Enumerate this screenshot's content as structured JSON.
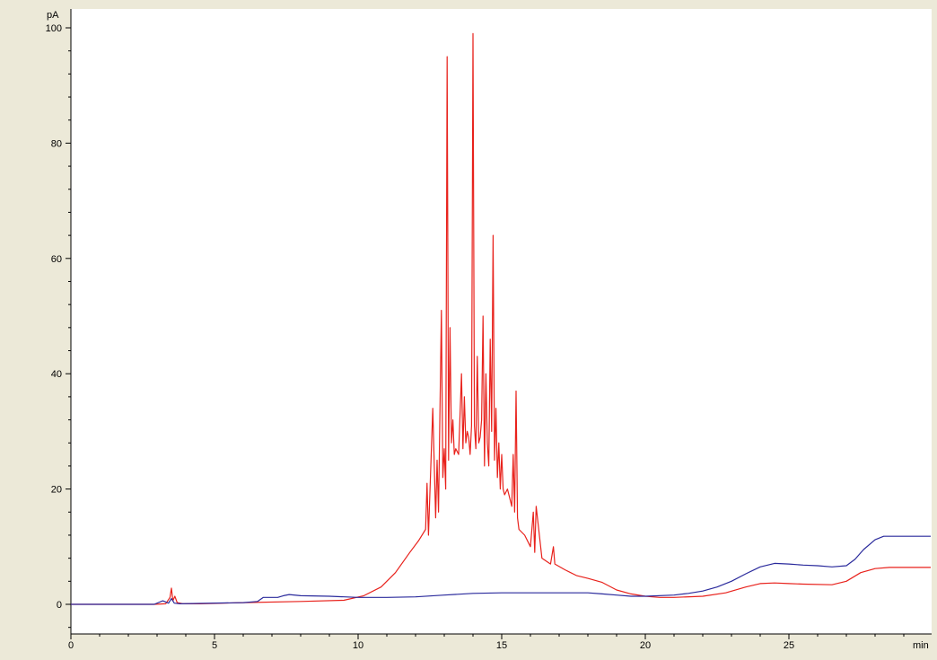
{
  "chart_data": {
    "type": "line",
    "xlabel": "min",
    "ylabel": "pA",
    "xlim": [
      0,
      30.2
    ],
    "ylim": [
      -5.5,
      102
    ],
    "x_ticks": [
      0,
      5,
      10,
      15,
      20,
      25
    ],
    "x_tick_labels": [
      "0",
      "5",
      "10",
      "15",
      "20",
      "25"
    ],
    "y_ticks": [
      0,
      20,
      40,
      60,
      80,
      100
    ],
    "y_tick_labels": [
      "0",
      "20",
      "40",
      "60",
      "80",
      "100"
    ],
    "grid": false,
    "colors": {
      "red_trace": "#e8221c",
      "blue_trace": "#2a2a9c"
    },
    "series": [
      {
        "color": "#e8221c",
        "x": [
          0,
          2.9,
          3.3,
          3.45,
          3.5,
          3.55,
          3.62,
          3.7,
          3.9,
          4.5,
          6,
          8,
          9.5,
          10.2,
          10.8,
          11.3,
          11.8,
          12.1,
          12.35,
          12.4,
          12.45,
          12.6,
          12.7,
          12.75,
          12.8,
          12.9,
          12.95,
          13.0,
          13.05,
          13.1,
          13.15,
          13.2,
          13.25,
          13.3,
          13.35,
          13.4,
          13.5,
          13.6,
          13.65,
          13.7,
          13.75,
          13.8,
          13.85,
          13.9,
          13.95,
          14.0,
          14.05,
          14.1,
          14.15,
          14.2,
          14.25,
          14.3,
          14.35,
          14.4,
          14.45,
          14.5,
          14.55,
          14.6,
          14.65,
          14.7,
          14.75,
          14.8,
          14.85,
          14.9,
          14.95,
          15.0,
          15.05,
          15.1,
          15.2,
          15.3,
          15.35,
          15.4,
          15.45,
          15.5,
          15.55,
          15.6,
          15.8,
          16.0,
          16.1,
          16.15,
          16.2,
          16.4,
          16.7,
          16.8,
          16.85,
          17.2,
          17.6,
          18.0,
          18.5,
          19.0,
          19.5,
          20.0,
          20.5,
          21.0,
          22.0,
          22.8,
          23.5,
          24.0,
          24.5,
          25.0,
          25.5,
          26.5,
          27.0,
          27.5,
          28.0,
          28.5,
          30.2
        ],
        "y": [
          0,
          0,
          0.1,
          1.2,
          2.8,
          0.6,
          1.4,
          0.3,
          0.1,
          0.1,
          0.3,
          0.5,
          0.7,
          1.5,
          3,
          5.5,
          9,
          11,
          13,
          21,
          12,
          34,
          15,
          25,
          16,
          51,
          22,
          27,
          20,
          95,
          25,
          48,
          28,
          32,
          26,
          27,
          26,
          40,
          27,
          36,
          28,
          30,
          29,
          26,
          31,
          99,
          31,
          27,
          43,
          28,
          29,
          32,
          50,
          24,
          40,
          28,
          24,
          46,
          30,
          64,
          25,
          34,
          22,
          28,
          20,
          26,
          20,
          19,
          20,
          18,
          17,
          26,
          16,
          37,
          15,
          13,
          12,
          10,
          16,
          9,
          17,
          8,
          7,
          10,
          7,
          6,
          5,
          4.5,
          3.8,
          2.5,
          1.8,
          1.4,
          1.2,
          1.2,
          1.4,
          2,
          3,
          3.6,
          3.7,
          3.6,
          3.5,
          3.4,
          4,
          5.5,
          6.2,
          6.4,
          6.4
        ]
      },
      {
        "color": "#2a2a9c",
        "x": [
          0,
          2.9,
          3.2,
          3.4,
          3.5,
          3.6,
          3.8,
          6.0,
          6.5,
          6.7,
          7.2,
          7.4,
          7.6,
          8.0,
          9.0,
          10.0,
          11.0,
          12.0,
          13.0,
          14.0,
          15.0,
          16.0,
          17.0,
          18.0,
          18.5,
          19.0,
          19.5,
          20.0,
          21.0,
          21.5,
          22.0,
          22.5,
          23.0,
          23.5,
          24.0,
          24.5,
          25.0,
          25.5,
          26.0,
          26.5,
          27.0,
          27.3,
          27.6,
          28.0,
          28.3,
          30.2
        ],
        "y": [
          0,
          0,
          0.6,
          0.2,
          1.0,
          0.2,
          0.1,
          0.3,
          0.5,
          1.2,
          1.2,
          1.5,
          1.7,
          1.5,
          1.4,
          1.2,
          1.2,
          1.3,
          1.6,
          1.9,
          2.0,
          2.0,
          2.0,
          2.0,
          1.8,
          1.6,
          1.4,
          1.4,
          1.6,
          1.9,
          2.3,
          3.0,
          4.0,
          5.3,
          6.5,
          7.1,
          7.0,
          6.8,
          6.7,
          6.5,
          6.7,
          7.8,
          9.5,
          11.2,
          11.8,
          11.8
        ]
      }
    ]
  }
}
